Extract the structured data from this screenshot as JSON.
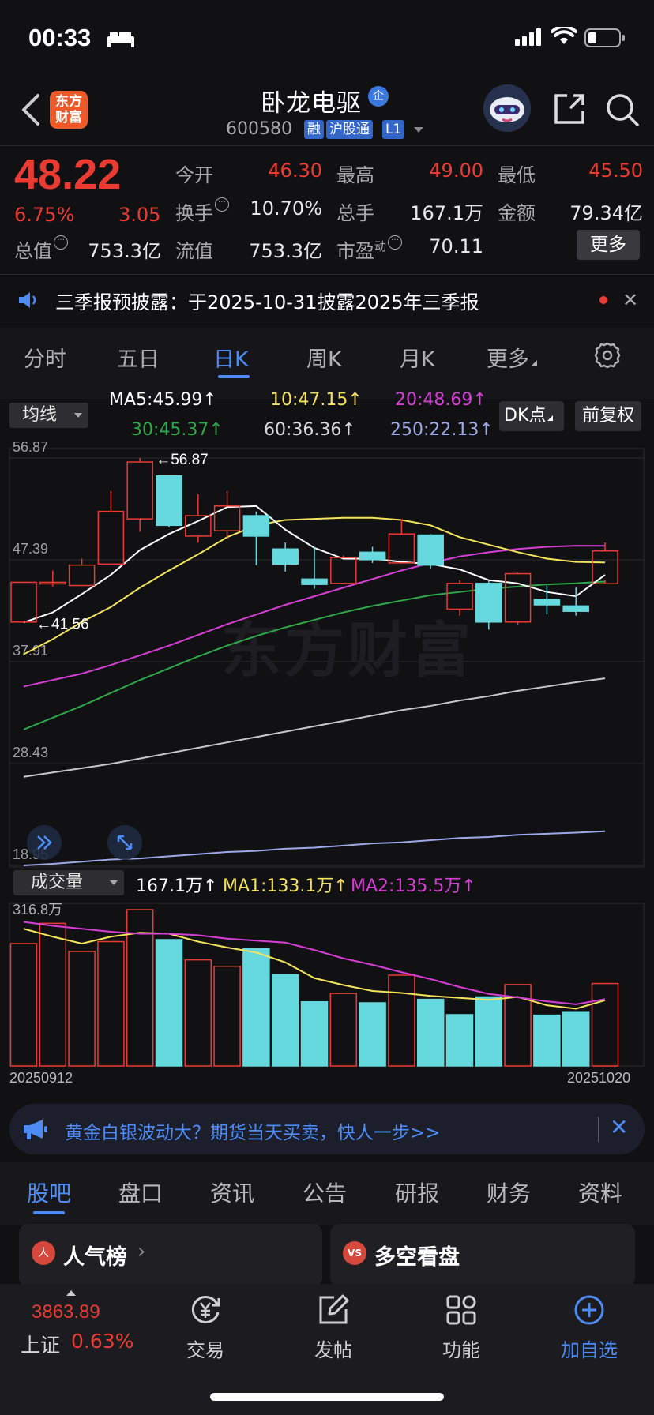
{
  "status_bar": {
    "time": "00:33"
  },
  "header": {
    "app_logo": "东方\n财富",
    "stock_name": "卧龙电驱",
    "corp_badge": "企",
    "stock_code": "600580",
    "tags": [
      "融",
      "沪股通",
      "L1"
    ]
  },
  "quote": {
    "price": "48.22",
    "change_pct": "6.75%",
    "change": "3.05",
    "open_label": "今开",
    "open": "46.30",
    "high_label": "最高",
    "high": "49.00",
    "low_label": "最低",
    "low": "45.50",
    "turnover_label": "换手",
    "turnover": "10.70%",
    "volume_label": "总手",
    "volume": "167.1万",
    "amount_label": "金额",
    "amount": "79.34亿",
    "total_cap_label": "总值",
    "total_cap": "753.3亿",
    "float_cap_label": "流值",
    "float_cap": "753.3亿",
    "pe_label": "市盈",
    "pe_sup": "动",
    "pe": "70.11",
    "more_label": "更多"
  },
  "notice": {
    "text": "三季报预披露：于2025-10-31披露2025年三季报"
  },
  "period_tabs": [
    "分时",
    "五日",
    "日K",
    "周K",
    "月K",
    "更多"
  ],
  "ma_header": {
    "select": "均线",
    "ma5": "MA5:45.99↑",
    "ma10": "10:47.15↑",
    "ma20": "20:48.69↑",
    "ma30": "30:45.37↑",
    "ma60": "60:36.36↑",
    "ma250": "250:22.13↑",
    "dk": "DK点",
    "adjust": "前复权"
  },
  "colors": {
    "up": "#ea3b33",
    "down": "#66d9de",
    "ma5": "#ffffff",
    "ma10": "#f5e35b",
    "ma20": "#d63ed6",
    "ma30": "#2ea84a",
    "ma60": "#c8c8c8",
    "ma250": "#9ea8e8",
    "accent": "#4d8cf5"
  },
  "chart_data": [
    {
      "type": "candlestick",
      "y_axis_labels": [
        "56.87",
        "47.39",
        "37.91",
        "28.43",
        "18.95"
      ],
      "ylim": [
        18.95,
        56.87
      ],
      "annotations": {
        "high": "←56.87",
        "low": "←41.56"
      },
      "watermark": "东方财富",
      "candles": [
        {
          "o": 41.6,
          "h": 45.3,
          "l": 41.56,
          "c": 45.3
        },
        {
          "o": 45.3,
          "h": 46.4,
          "l": 44.9,
          "c": 45.3
        },
        {
          "o": 45.0,
          "h": 47.5,
          "l": 45.0,
          "c": 46.9
        },
        {
          "o": 47.0,
          "h": 53.8,
          "l": 47.0,
          "c": 51.9
        },
        {
          "o": 51.2,
          "h": 56.87,
          "l": 50.0,
          "c": 56.5
        },
        {
          "o": 55.2,
          "h": 55.2,
          "l": 50.4,
          "c": 50.6
        },
        {
          "o": 49.6,
          "h": 53.5,
          "l": 49.0,
          "c": 51.5
        },
        {
          "o": 50.1,
          "h": 53.8,
          "l": 49.3,
          "c": 52.4
        },
        {
          "o": 51.5,
          "h": 51.9,
          "l": 46.9,
          "c": 49.6
        },
        {
          "o": 48.4,
          "h": 49.0,
          "l": 46.3,
          "c": 47.0
        },
        {
          "o": 45.6,
          "h": 48.6,
          "l": 44.7,
          "c": 45.1
        },
        {
          "o": 45.2,
          "h": 47.8,
          "l": 45.2,
          "c": 47.6
        },
        {
          "o": 48.1,
          "h": 48.6,
          "l": 47.1,
          "c": 47.4
        },
        {
          "o": 47.1,
          "h": 51.2,
          "l": 47.1,
          "c": 49.8
        },
        {
          "o": 49.7,
          "h": 49.8,
          "l": 46.6,
          "c": 46.9
        },
        {
          "o": 42.8,
          "h": 45.5,
          "l": 42.2,
          "c": 45.2
        },
        {
          "o": 45.2,
          "h": 45.4,
          "l": 40.9,
          "c": 41.6
        },
        {
          "o": 41.6,
          "h": 46.2,
          "l": 41.3,
          "c": 46.1
        },
        {
          "o": 43.7,
          "h": 45.0,
          "l": 42.3,
          "c": 43.2
        },
        {
          "o": 43.1,
          "h": 44.8,
          "l": 42.2,
          "c": 42.6
        },
        {
          "o": 45.17,
          "h": 49.0,
          "l": 45.5,
          "c": 48.22
        }
      ],
      "ma_series": {
        "ma5": [
          41.56,
          42.5,
          44.2,
          46.0,
          48.3,
          49.8,
          51.0,
          52.3,
          52.4,
          50.2,
          48.5,
          47.5,
          47.5,
          47.2,
          47.0,
          46.5,
          45.5,
          45.2,
          44.4,
          44.0,
          45.99
        ],
        "ma10": [
          38.6,
          40.0,
          41.6,
          43.0,
          44.8,
          46.4,
          47.9,
          49.5,
          50.6,
          51.1,
          51.2,
          51.3,
          51.3,
          51.1,
          50.6,
          49.5,
          48.8,
          48.1,
          47.5,
          47.2,
          47.15
        ],
        "ma20": [
          35.6,
          36.2,
          36.8,
          37.6,
          38.5,
          39.4,
          40.4,
          41.4,
          42.3,
          43.2,
          44.0,
          44.8,
          45.6,
          46.4,
          47.1,
          47.7,
          48.1,
          48.4,
          48.6,
          48.7,
          48.69
        ],
        "ma30": [
          31.6,
          32.7,
          33.8,
          35.0,
          36.2,
          37.3,
          38.4,
          39.4,
          40.3,
          41.1,
          41.8,
          42.5,
          43.1,
          43.6,
          44.1,
          44.4,
          44.7,
          44.9,
          45.1,
          45.2,
          45.37
        ],
        "ma60": [
          27.2,
          27.6,
          28.0,
          28.4,
          28.9,
          29.4,
          29.9,
          30.4,
          30.9,
          31.4,
          31.9,
          32.4,
          32.9,
          33.4,
          33.8,
          34.3,
          34.7,
          35.2,
          35.6,
          36.0,
          36.36
        ],
        "ma250": [
          18.95,
          19.1,
          19.3,
          19.5,
          19.6,
          19.8,
          20.0,
          20.2,
          20.3,
          20.5,
          20.6,
          20.8,
          21.0,
          21.1,
          21.3,
          21.5,
          21.6,
          21.8,
          21.9,
          22.0,
          22.13
        ]
      }
    },
    {
      "type": "bar",
      "title": "成交量",
      "y_top_label": "316.8万",
      "legend": {
        "total": "167.1万↑",
        "ma1": "MA1:133.1万↑",
        "ma2": "MA2:135.5万↑"
      },
      "ylim": [
        0,
        316.8
      ],
      "x_labels": [
        "20250912",
        "20251020"
      ],
      "values": [
        248,
        289,
        232,
        252,
        316.8,
        256,
        215,
        202,
        238,
        185,
        130,
        147,
        128,
        184,
        135,
        104,
        140,
        165,
        103,
        110,
        167.1
      ],
      "up": [
        true,
        true,
        true,
        true,
        true,
        false,
        true,
        true,
        false,
        false,
        false,
        true,
        false,
        true,
        false,
        false,
        false,
        true,
        false,
        false,
        true
      ],
      "ma1": [
        278,
        262,
        248,
        262,
        270,
        268,
        252,
        240,
        230,
        210,
        178,
        164,
        152,
        148,
        142,
        138,
        134,
        140,
        123,
        116,
        133.1
      ],
      "ma2": [
        292,
        284,
        278,
        272,
        268,
        268,
        265,
        258,
        254,
        250,
        235,
        218,
        205,
        190,
        176,
        160,
        146,
        139,
        131,
        125,
        135.5
      ]
    }
  ],
  "ad_banner": {
    "text": "黄金白银波动大？期货当天买卖，快人一步>>"
  },
  "content_tabs": [
    "股吧",
    "盘口",
    "资讯",
    "公告",
    "研报",
    "财务",
    "资料"
  ],
  "cards": [
    {
      "title": "人气榜",
      "icon": "人"
    },
    {
      "title": "多空看盘",
      "icon": "VS"
    }
  ],
  "bottom_nav": {
    "index_value": "3863.89",
    "index_name": "上证",
    "index_pct": "0.63%",
    "items": [
      "交易",
      "发帖",
      "功能",
      "加自选"
    ]
  }
}
